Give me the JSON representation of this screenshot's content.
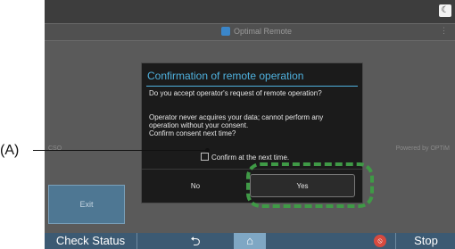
{
  "app": {
    "title": "Optimal Remote",
    "menu_icon": "more-vertical-icon"
  },
  "status_bar": {
    "icon": "moon-icon"
  },
  "side": {
    "left_label": "CSO",
    "powered_by": "Powered by OPTiM"
  },
  "exit_button": {
    "label": "Exit"
  },
  "dialog": {
    "title": "Confirmation of remote operation",
    "question": "Do you accept operator's request of remote operation?",
    "body": [
      "Operator never acquires your data; cannot perform any",
      "operation without your consent.",
      "Confirm consent next time?"
    ],
    "checkbox_label": "Confirm at the next time.",
    "no_label": "No",
    "yes_label": "Yes"
  },
  "callout": {
    "label": "(A)"
  },
  "bottom_bar": {
    "check_status": "Check Status",
    "back_icon": "back-icon",
    "home_icon": "home-icon",
    "stop_icon": "stop-icon",
    "stop_label": "Stop"
  },
  "colors": {
    "accent": "#4fb1de",
    "highlight": "#3f9a46",
    "bottom_bar": "#3c5a73",
    "stop": "#d74a3f"
  }
}
